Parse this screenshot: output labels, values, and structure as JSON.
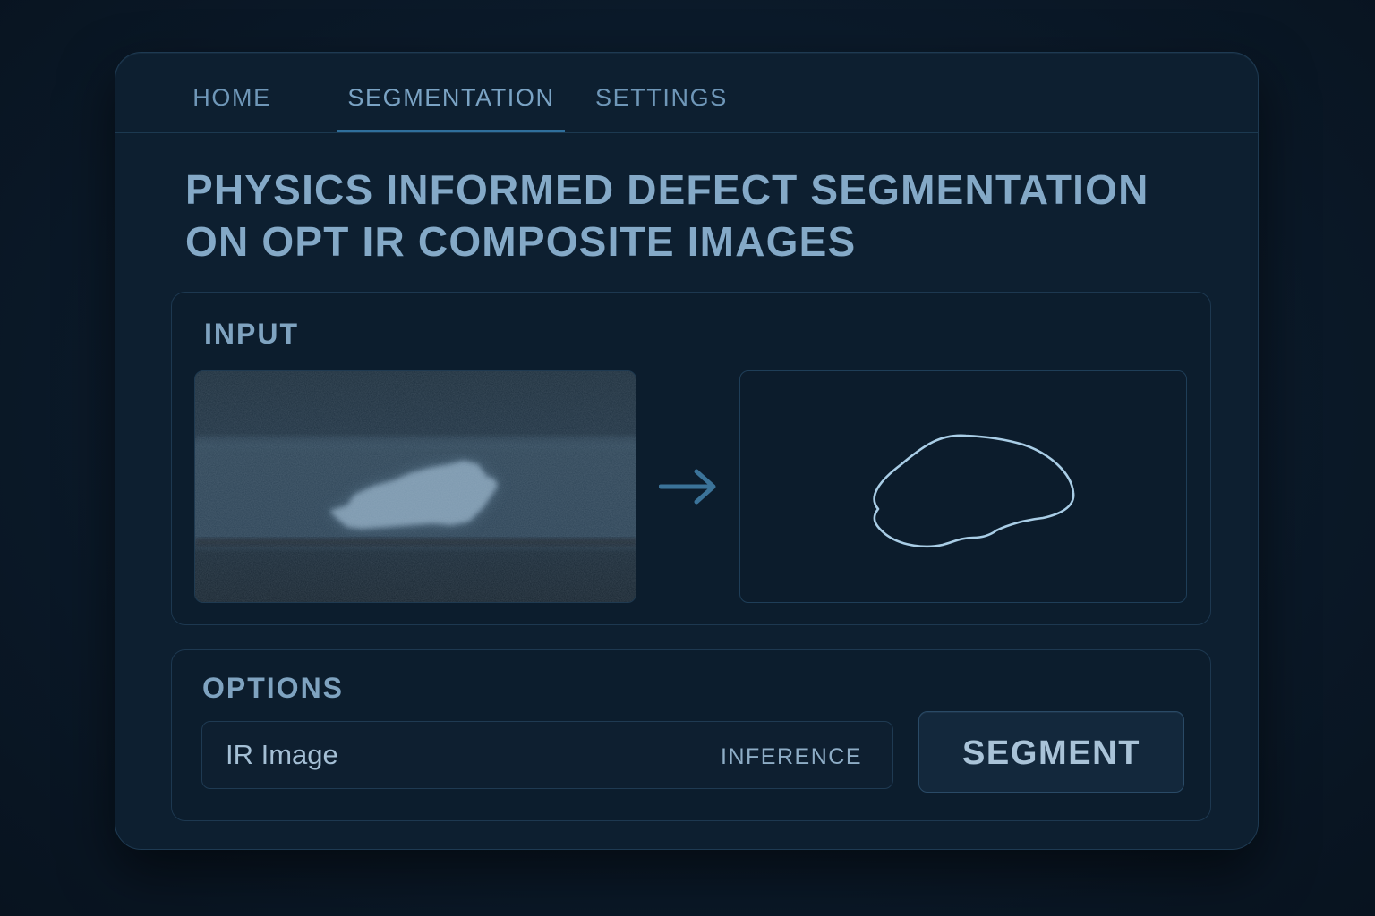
{
  "nav": {
    "tabs": [
      {
        "label": "HOME",
        "active": false
      },
      {
        "label": "SEGMENTATION",
        "active": true
      },
      {
        "label": "SETTINGS",
        "active": false
      }
    ]
  },
  "title": {
    "line1": "PHYSICS INFORMED DEFECT SEGMENTATION",
    "line2": "ON OPT IR COMPOSITE IMAGES"
  },
  "input_panel": {
    "label": "INPUT",
    "input_image_icon": "ir-thermal-image",
    "arrow_icon": "arrow-right-icon",
    "output_icon": "defect-contour-outline"
  },
  "options_panel": {
    "label": "OPTIONS",
    "field_value": "IR Image",
    "field_mode": "INFERENCE",
    "segment_label": "SEGMENT"
  },
  "colors": {
    "background": "#0b1a2a",
    "window": "#0d1f30",
    "accent": "#2f6f9c",
    "text": "#84a9c7",
    "contour": "#a9cde6"
  }
}
